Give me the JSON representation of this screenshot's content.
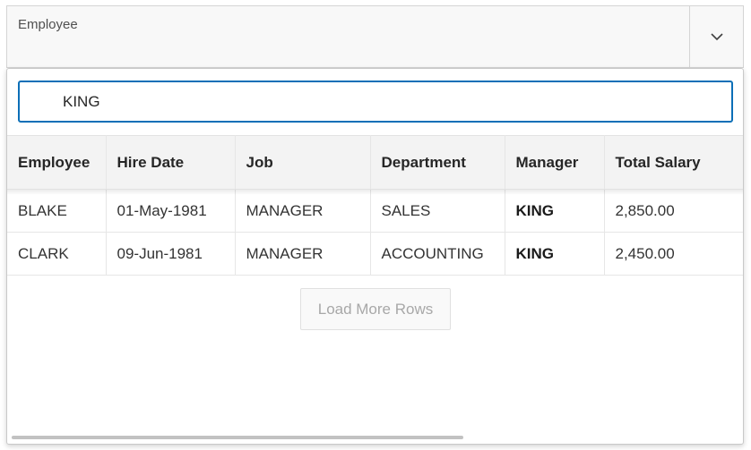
{
  "field": {
    "label": "Employee",
    "toggle_icon": "chevron-down-icon"
  },
  "search": {
    "value": "KING",
    "placeholder": ""
  },
  "grid": {
    "columns": [
      "Employee",
      "Hire Date",
      "Job",
      "Department",
      "Manager",
      "Total Salary"
    ],
    "rows": [
      [
        "BLAKE",
        "01-May-1981",
        "MANAGER",
        "SALES",
        "KING",
        "2,850.00"
      ],
      [
        "CLARK",
        "09-Jun-1981",
        "MANAGER",
        "ACCOUNTING",
        "KING",
        "2,450.00"
      ]
    ]
  },
  "load_more": {
    "label": "Load More Rows"
  },
  "colors": {
    "focus_border": "#0c6fb7",
    "header_bg": "#f3f3f3"
  }
}
